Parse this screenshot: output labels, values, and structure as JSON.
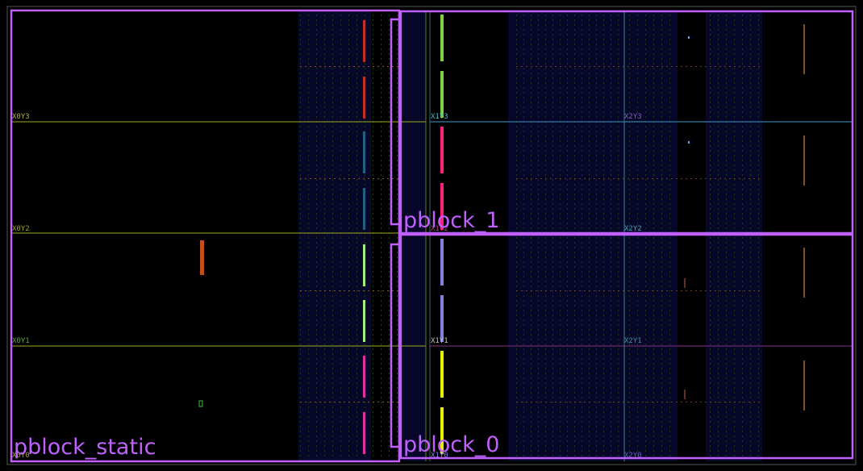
{
  "device_view": {
    "clock_regions": [
      {
        "name": "X0Y3",
        "color": "#b0b040"
      },
      {
        "name": "X0Y2",
        "color": "#a0a030"
      },
      {
        "name": "X0Y1",
        "color": "#60a040"
      },
      {
        "name": "X0Y0",
        "color": "#a0a040"
      },
      {
        "name": "X1Y3",
        "color": "#40c0c0"
      },
      {
        "name": "X1Y2",
        "color": "#b04080"
      },
      {
        "name": "X1Y1",
        "color": "#c0c0c0"
      },
      {
        "name": "X1Y0",
        "color": "#8080ff"
      },
      {
        "name": "X2Y3",
        "color": "#8060c0"
      },
      {
        "name": "X2Y2",
        "color": "#40a0c0"
      },
      {
        "name": "X2Y1",
        "color": "#4090b0"
      },
      {
        "name": "X2Y0",
        "color": "#6060c0"
      }
    ],
    "pblocks": [
      {
        "name": "pblock_static",
        "label": "pblock_static",
        "color": "#c060ff"
      },
      {
        "name": "pblock_1",
        "label": "pblock_1",
        "color": "#c060ff"
      },
      {
        "name": "pblock_0",
        "label": "pblock_0",
        "color": "#c060ff"
      }
    ],
    "colors": {
      "background": "#000000",
      "fabric_column": "#0b0b35",
      "pblock": "#c060ff",
      "region_line_left": "#7d8a1a",
      "region_line_right": "#3a7aa0"
    }
  }
}
